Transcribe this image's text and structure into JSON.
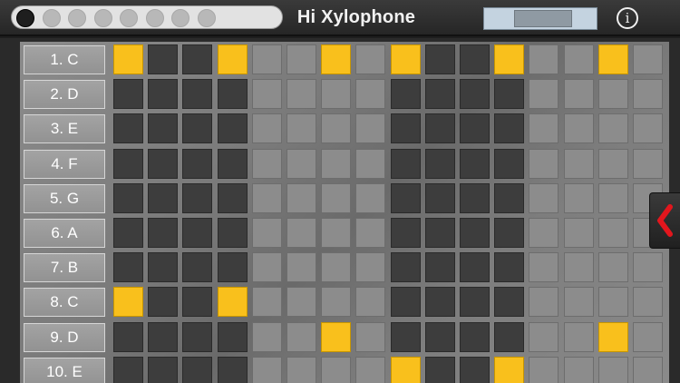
{
  "app_title": "Hi Xylophone",
  "pattern_slots": {
    "count": 8,
    "active_index": 0
  },
  "tempo": {
    "fraction": 0.55
  },
  "info_icon": "i",
  "collapse_tab_icon": "chevron-left-icon",
  "accent_color": "#f9c01c",
  "rows": [
    {
      "label": "1. C",
      "active_steps": [
        0,
        3,
        6,
        8,
        11,
        14
      ]
    },
    {
      "label": "2. D",
      "active_steps": []
    },
    {
      "label": "3. E",
      "active_steps": []
    },
    {
      "label": "4. F",
      "active_steps": []
    },
    {
      "label": "5. G",
      "active_steps": []
    },
    {
      "label": "6. A",
      "active_steps": []
    },
    {
      "label": "7. B",
      "active_steps": []
    },
    {
      "label": "8. C",
      "active_steps": [
        0,
        3
      ]
    },
    {
      "label": "9. D",
      "active_steps": [
        6,
        14
      ]
    },
    {
      "label": "10. E",
      "active_steps": [
        8,
        11
      ]
    }
  ],
  "steps_per_row": 16
}
